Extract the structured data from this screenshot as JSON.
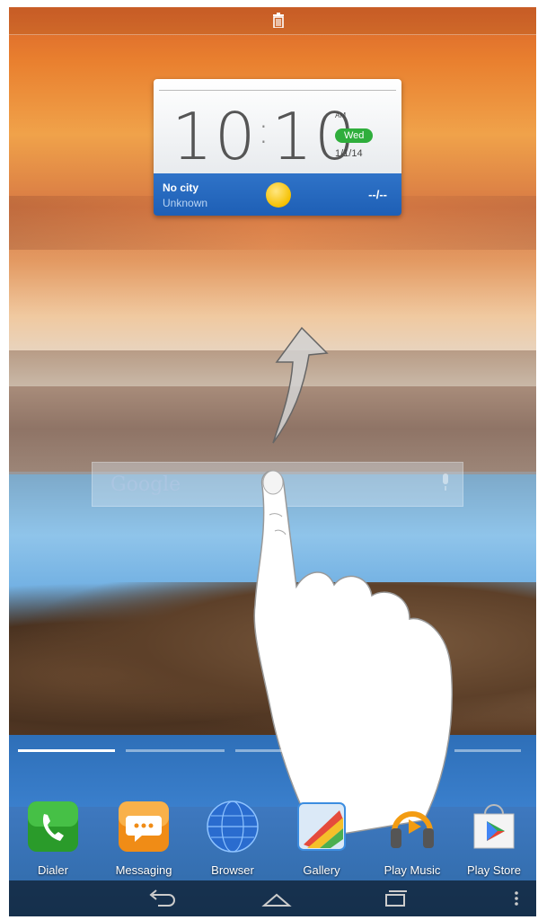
{
  "clock": {
    "hours": "10",
    "minutes": "10",
    "ampm": "AM",
    "day": "Wed",
    "date": "1/1/14"
  },
  "weather": {
    "city": "No city",
    "condition": "Unknown",
    "temp": "--/--",
    "icon": "sun-icon"
  },
  "search": {
    "logo_text": "Google"
  },
  "dock": {
    "apps": [
      {
        "label": "Dialer",
        "icon": "phone-icon",
        "color": "#2a9b2a"
      },
      {
        "label": "Messaging",
        "icon": "message-icon",
        "color": "#f08c16"
      },
      {
        "label": "Browser",
        "icon": "globe-icon",
        "color": "#2a6ccf"
      },
      {
        "label": "Gallery",
        "icon": "gallery-icon",
        "color": "#3c8de0"
      },
      {
        "label": "Play Music",
        "icon": "headphones-icon",
        "color": "#f39c12"
      },
      {
        "label": "Play Store",
        "icon": "play-store-icon",
        "color": "#e8e8e8"
      }
    ]
  },
  "status_bar": {
    "icon": "trash-icon"
  },
  "nav": {
    "buttons": [
      "back-icon",
      "home-icon",
      "recent-apps-icon",
      "overflow-menu-icon"
    ]
  },
  "colors": {
    "widget_blue": "#1e5fb5",
    "day_badge_green": "#2fae3c"
  }
}
